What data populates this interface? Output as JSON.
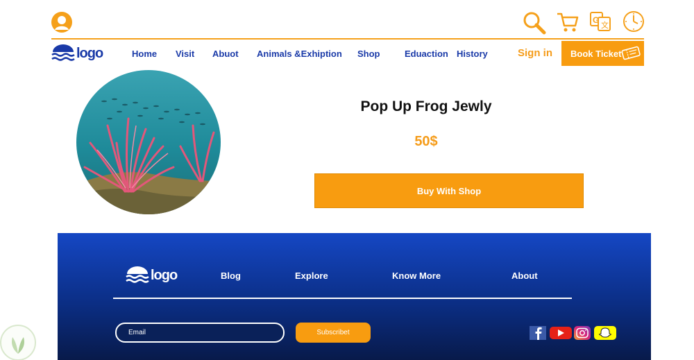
{
  "header": {
    "logo_text": "logo",
    "icons": [
      "user-icon",
      "search-icon",
      "cart-icon",
      "translate-icon",
      "clock-icon"
    ]
  },
  "nav": {
    "items": [
      "Home",
      "Visit",
      "Abuot",
      "Animals &Exhiption",
      "Shop",
      "Eduaction",
      "History"
    ],
    "sign_in": "Sign in",
    "book_ticket": "Book Ticket"
  },
  "product": {
    "title": "Pop Up Frog Jewly",
    "price": "50$",
    "buy_label": "Buy With Shop"
  },
  "footer": {
    "logo_text": "logo",
    "links": [
      "Blog",
      "Explore",
      "Know More",
      "About"
    ],
    "email_placeholder": "Email",
    "subscribe_label": "Subscribet",
    "social_icons": [
      "facebook-icon",
      "youtube-icon",
      "instagram-icon",
      "snapchat-icon"
    ]
  },
  "colors": {
    "accent": "#f89c10",
    "nav_text": "#1a3aa8",
    "footer_top": "#1547c4",
    "footer_bottom": "#081a4a"
  }
}
